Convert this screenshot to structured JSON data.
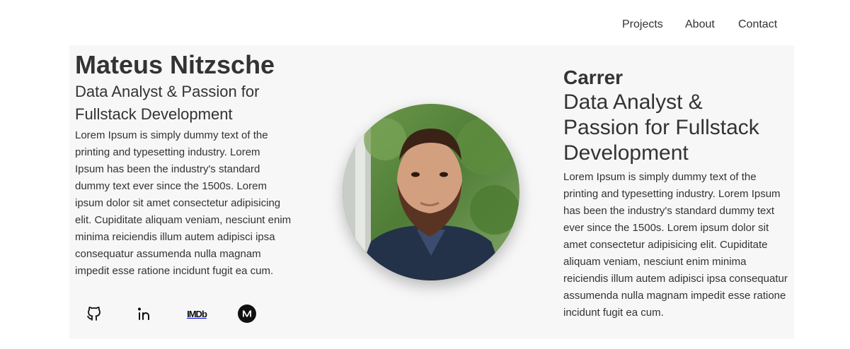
{
  "nav": {
    "items": [
      "Projects",
      "About",
      "Contact"
    ]
  },
  "profile": {
    "name": "Mateus Nitzsche",
    "subtitle": "Data Analyst & Passion for Fullstack Development",
    "bio": "Lorem Ipsum is simply dummy text of the printing and typesetting industry. Lorem Ipsum has been the industry's standard dummy text ever since the 1500s. Lorem ipsum dolor sit amet consectetur adipisicing elit. Cupiditate aliquam veniam, nesciunt enim minima reiciendis illum autem adipisci ipsa consequatur assumenda nulla magnam impedit esse ratione incidunt fugit ea cum."
  },
  "socials": [
    {
      "icon": "github-icon"
    },
    {
      "icon": "linkedin-icon"
    },
    {
      "icon": "imdb-icon",
      "label": "IMDb"
    },
    {
      "icon": "medium-icon"
    }
  ],
  "career": {
    "heading": "Carrer",
    "subtitle": "Data Analyst & Passion for Fullstack Development",
    "text": "Lorem Ipsum is simply dummy text of the printing and typesetting industry. Lorem Ipsum has been the industry's standard dummy text ever since the 1500s. Lorem ipsum dolor sit amet consectetur adipisicing elit. Cupiditate aliquam veniam, nesciunt enim minima reiciendis illum autem adipisci ipsa consequatur assumenda nulla magnam impedit esse ratione incidunt fugit ea cum."
  },
  "colors": {
    "panel_background": "#f7f7f7",
    "text": "#333333"
  }
}
